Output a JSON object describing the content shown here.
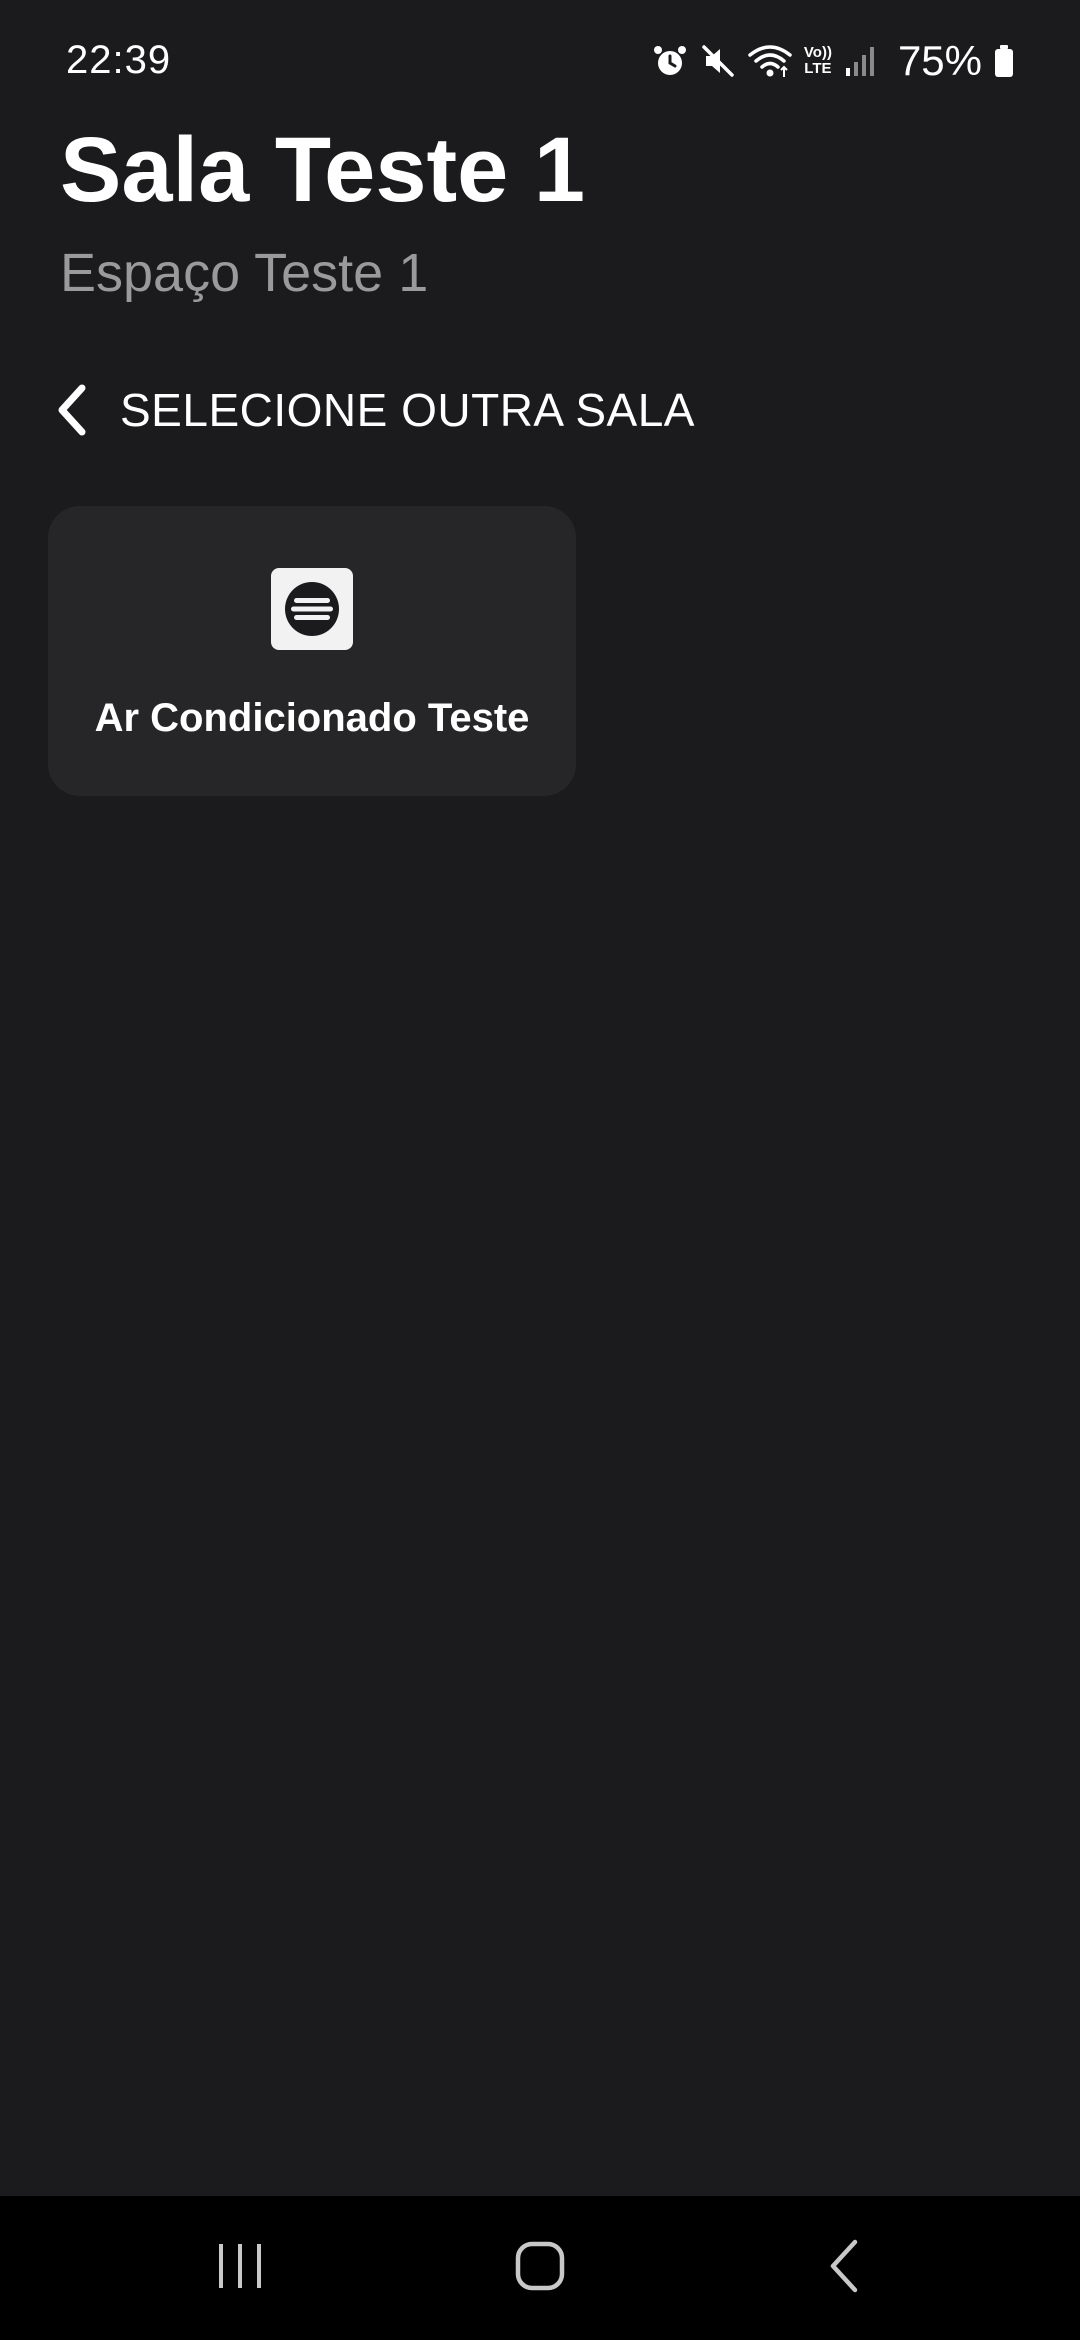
{
  "status_bar": {
    "time": "22:39",
    "icons": [
      "alarm-icon",
      "mute-icon",
      "wifi-icon",
      "volte-lte-icon",
      "signal-icon",
      "battery-icon"
    ],
    "volte_label": "Vo))",
    "lte_label": "LTE",
    "battery_percent": "75%"
  },
  "header": {
    "title": "Sala Teste 1",
    "subtitle": "Espaço Teste 1"
  },
  "back_link": {
    "icon": "chevron-left-icon",
    "label": "SELECIONE OUTRA SALA"
  },
  "devices": [
    {
      "icon": "air-conditioner-icon",
      "label": "Ar Condicionado Teste"
    }
  ],
  "nav_bar": {
    "buttons": [
      "recent-apps-icon",
      "home-icon",
      "back-icon"
    ]
  },
  "colors": {
    "background": "#1b1b1d",
    "card": "#262628",
    "subtitle": "#9a9a9d",
    "text": "#ffffff",
    "nav_bar": "#000000"
  }
}
